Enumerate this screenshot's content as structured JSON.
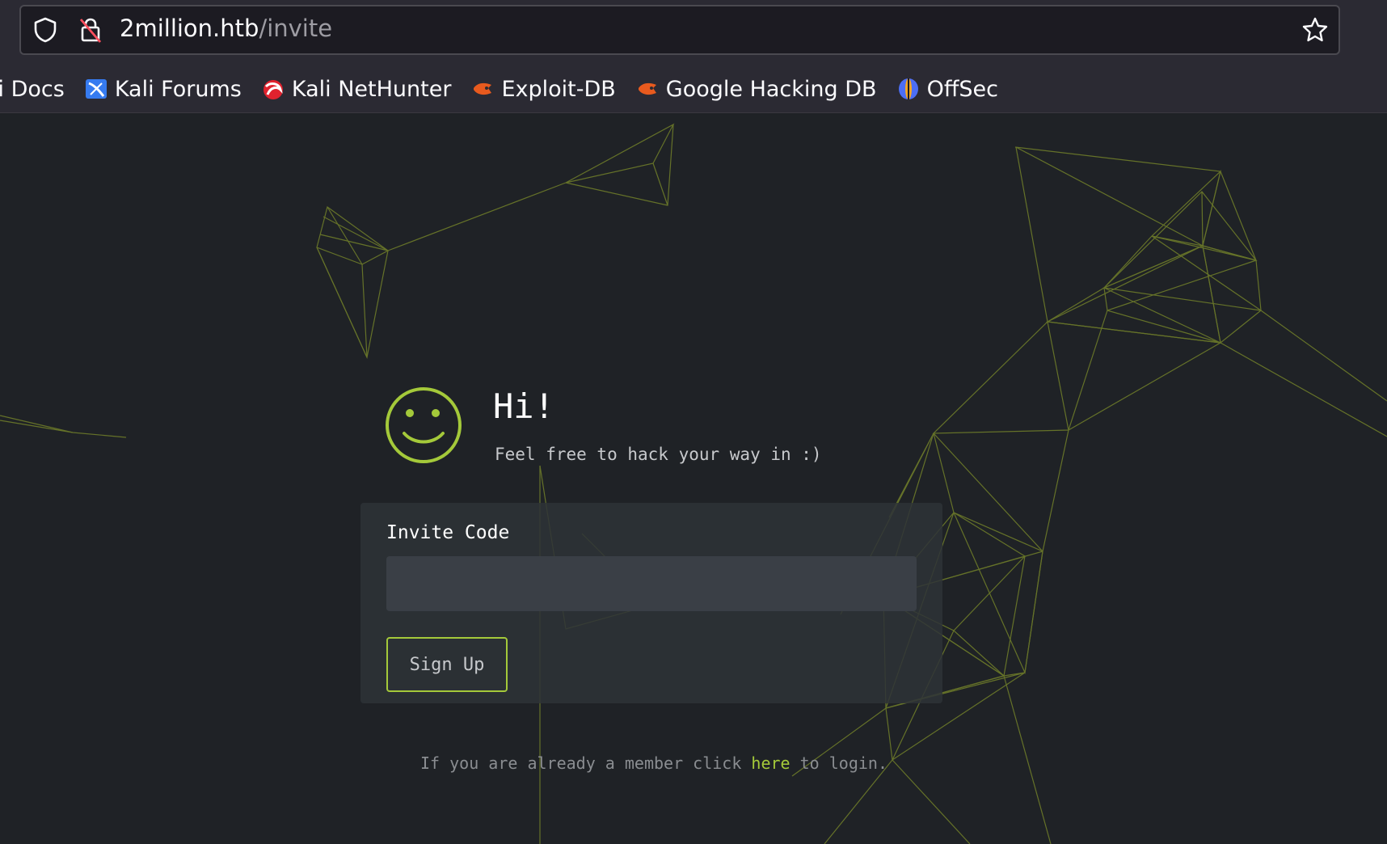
{
  "browser": {
    "url_host": "2million.htb",
    "url_path": "/invite",
    "bookmarks": [
      {
        "label": "li Docs",
        "icon": "kali-docs-icon"
      },
      {
        "label": "Kali Forums",
        "icon": "kali-forums-icon"
      },
      {
        "label": "Kali NetHunter",
        "icon": "kali-nethunter-icon"
      },
      {
        "label": "Exploit-DB",
        "icon": "exploit-db-icon"
      },
      {
        "label": "Google Hacking DB",
        "icon": "ghdb-icon"
      },
      {
        "label": "OffSec",
        "icon": "offsec-icon"
      }
    ]
  },
  "page": {
    "greeting": "Hi!",
    "subtitle": "Feel free to hack your way in :)",
    "form": {
      "label": "Invite Code",
      "input_value": "",
      "input_placeholder": "",
      "button_label": "Sign Up"
    },
    "login": {
      "prefix": "If you are already a member click ",
      "link_text": "here",
      "suffix": " to login."
    }
  },
  "colors": {
    "accent": "#a4c93a",
    "background": "#1f2226",
    "card": "#2e3237"
  }
}
